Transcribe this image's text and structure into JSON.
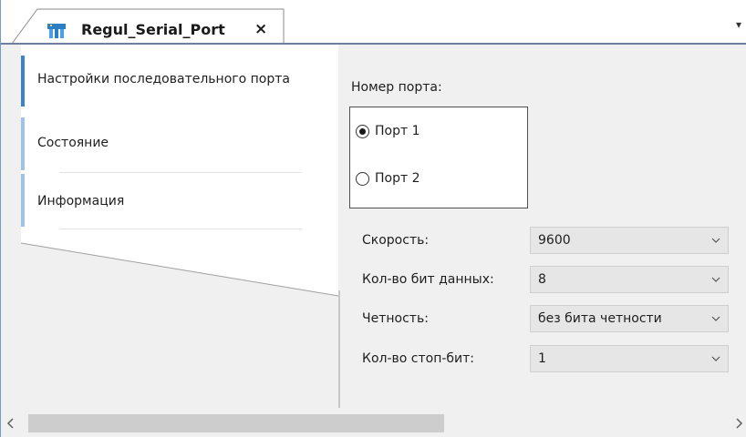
{
  "tab": {
    "title": "Regul_Serial_Port",
    "close_glyph": "×",
    "icon": "device-module-icon",
    "dropdown_glyph": "▾"
  },
  "nav": {
    "items": [
      {
        "label": "Настройки последовательного порта",
        "active": true
      },
      {
        "label": "Состояние",
        "active": false
      },
      {
        "label": "Информация",
        "active": false
      }
    ]
  },
  "port": {
    "label": "Номер порта:",
    "options": [
      {
        "label": "Порт 1",
        "checked": true
      },
      {
        "label": "Порт 2",
        "checked": false
      }
    ]
  },
  "fields": [
    {
      "label": "Скорость:",
      "value": "9600"
    },
    {
      "label": "Кол-во бит данных:",
      "value": "8"
    },
    {
      "label": "Четность:",
      "value": "без бита четности"
    },
    {
      "label": "Кол-во стоп-бит:",
      "value": "1"
    }
  ],
  "scrollbar": {
    "left_glyph": "‹",
    "right_glyph": "›",
    "position_fraction": 0
  },
  "colors": {
    "accent": "#3e82cb",
    "tab_line": "#6e7fa0",
    "panel_bg": "#f0f0f0",
    "combo_bg": "#e6e6e6"
  }
}
